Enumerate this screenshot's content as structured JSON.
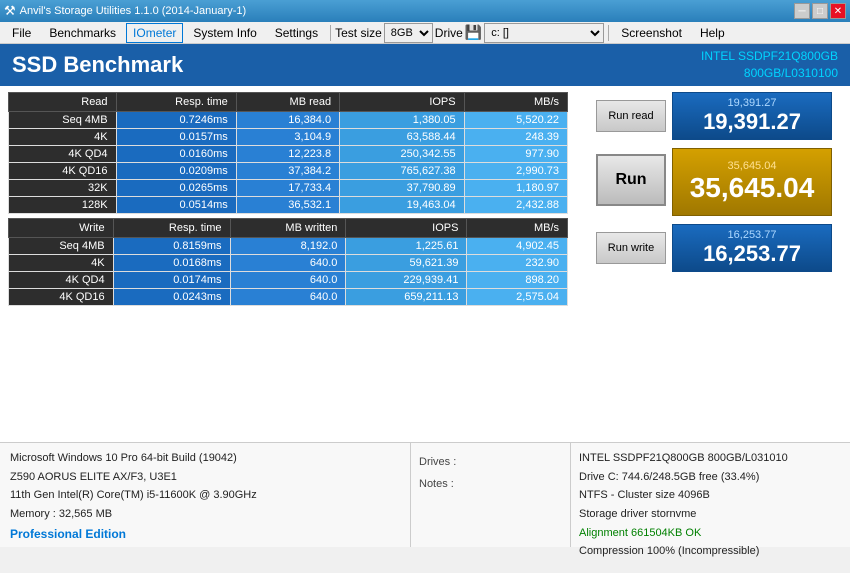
{
  "titlebar": {
    "icon": "anvil-icon",
    "title": "Anvil's Storage Utilities 1.1.0 (2014-January-1)",
    "minimize": "─",
    "maximize": "□",
    "close": "✕"
  },
  "menu": {
    "file": "File",
    "benchmarks": "Benchmarks",
    "iometer": "IOmeter",
    "systeminfo": "System Info",
    "settings": "Settings",
    "testsize_label": "Test size",
    "testsize_value": "8GB",
    "drive_label": "Drive",
    "drive_icon": "drive-icon",
    "drive_value": "c: []",
    "screenshot": "Screenshot",
    "help": "Help"
  },
  "banner": {
    "title": "SSD Benchmark",
    "drive_model": "INTEL SSDPF21Q800GB",
    "drive_detail": "800GB/L0310100"
  },
  "read_table": {
    "headers": [
      "Read",
      "Resp. time",
      "MB read",
      "IOPS",
      "MB/s"
    ],
    "rows": [
      [
        "Seq 4MB",
        "0.7246ms",
        "16,384.0",
        "1,380.05",
        "5,520.22"
      ],
      [
        "4K",
        "0.0157ms",
        "3,104.9",
        "63,588.44",
        "248.39"
      ],
      [
        "4K QD4",
        "0.0160ms",
        "12,223.8",
        "250,342.55",
        "977.90"
      ],
      [
        "4K QD16",
        "0.0209ms",
        "37,384.2",
        "765,627.38",
        "2,990.73"
      ],
      [
        "32K",
        "0.0265ms",
        "17,733.4",
        "37,790.89",
        "1,180.97"
      ],
      [
        "128K",
        "0.0514ms",
        "36,532.1",
        "19,463.04",
        "2,432.88"
      ]
    ]
  },
  "write_table": {
    "headers": [
      "Write",
      "Resp. time",
      "MB written",
      "IOPS",
      "MB/s"
    ],
    "rows": [
      [
        "Seq 4MB",
        "0.8159ms",
        "8,192.0",
        "1,225.61",
        "4,902.45"
      ],
      [
        "4K",
        "0.0168ms",
        "640.0",
        "59,621.39",
        "232.90"
      ],
      [
        "4K QD4",
        "0.0174ms",
        "640.0",
        "229,939.41",
        "898.20"
      ],
      [
        "4K QD16",
        "0.0243ms",
        "640.0",
        "659,211.13",
        "2,575.04"
      ]
    ]
  },
  "scores": {
    "run_read_label": "Run read",
    "read_score_small": "19,391.27",
    "read_score_big": "19,391.27",
    "run_label": "Run",
    "total_score_small": "35,645.04",
    "total_score_big": "35,645.04",
    "run_write_label": "Run write",
    "write_score_small": "16,253.77",
    "write_score_big": "16,253.77"
  },
  "sysinfo": {
    "os": "Microsoft Windows 10 Pro 64-bit Build (19042)",
    "mobo": "Z590 AORUS ELITE AX/F3, U3E1",
    "cpu": "11th Gen Intel(R) Core(TM) i5-11600K @ 3.90GHz",
    "memory": "Memory : 32,565 MB",
    "edition": "Professional Edition"
  },
  "drives_notes": {
    "drives_label": "Drives :",
    "notes_label": "Notes :"
  },
  "drive_details": {
    "model": "INTEL SSDPF21Q800GB 800GB/L031010",
    "capacity": "Drive C: 744.6/248.5GB free (33.4%)",
    "fs": "NTFS - Cluster size 4096B",
    "driver": "Storage driver  stornvme",
    "alignment": "Alignment 661504KB OK",
    "compression": "Compression 100% (Incompressible)"
  }
}
